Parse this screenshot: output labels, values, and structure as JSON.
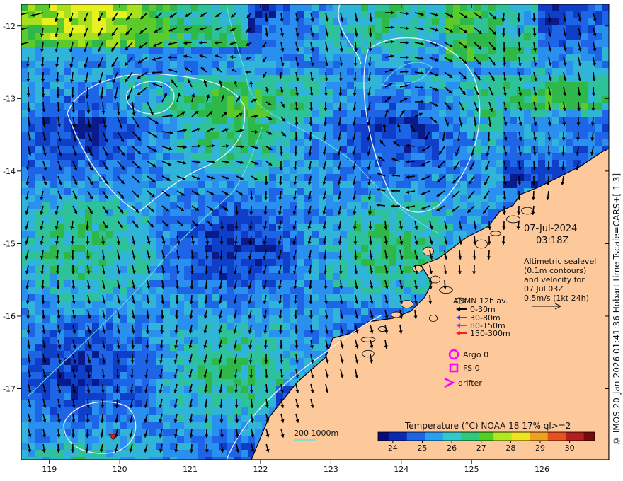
{
  "map": {
    "date": "07-Jul-2024",
    "time": "03:18Z",
    "x_ticks": [
      "119",
      "120",
      "121",
      "122",
      "123",
      "124",
      "125",
      "126"
    ],
    "y_ticks": [
      "-12",
      "-13",
      "-14",
      "-15",
      "-16",
      "-17"
    ],
    "lon_range": [
      118.6,
      126.95
    ],
    "lat_range": [
      -17.98,
      -11.7
    ]
  },
  "info": {
    "line1": "Altimetric sealevel",
    "line2": "(0.1m contours)",
    "line3": "and velocity for",
    "line4": "07 Jul 03Z",
    "line5": "0.5m/s (1kt 24h)"
  },
  "legend": {
    "title": "ANMN 12h av.",
    "items": [
      {
        "label": "0-30m",
        "color": "#000000"
      },
      {
        "label": "30-80m",
        "color": "#1e50ff"
      },
      {
        "label": "80-150m",
        "color": "#a040ff"
      },
      {
        "label": "150-300m",
        "color": "#ff1a1a"
      }
    ],
    "argo": "Argo 0",
    "fs": "FS 0",
    "drifter": "drifter",
    "marker_color": "#ff00ff"
  },
  "bathy": {
    "label": "200  1000m",
    "color": "#66e0e0"
  },
  "colorbar": {
    "title": "Temperature (°C) NOAA 18 17% ql>=2",
    "ticks": [
      "24",
      "25",
      "26",
      "27",
      "28",
      "29",
      "30"
    ]
  },
  "credit": "© IMOS 20-Jan-2026 01:41:36 Hobart time Tscale=CARS+[-1 3]",
  "colors": {
    "land": "#fdc89a",
    "ocean_blue": "#1e64d2",
    "coast": "#000000"
  }
}
